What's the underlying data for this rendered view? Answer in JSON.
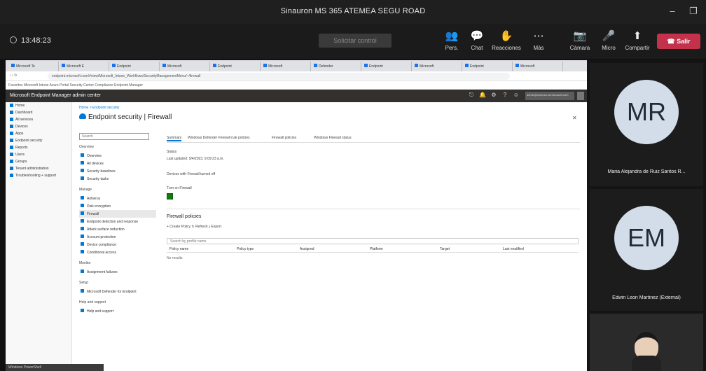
{
  "window": {
    "title": "Sinauron MS 365 ATEMEA SEGU ROAD",
    "min": "–",
    "restore": "❐"
  },
  "meeting": {
    "timer": "13:48:23",
    "take_control": "Solicitar control",
    "tools": [
      {
        "icon": "people-icon",
        "glyph": "👥",
        "label": "Pers."
      },
      {
        "icon": "chat-icon",
        "glyph": "💬",
        "label": "Chat"
      },
      {
        "icon": "reactions-icon",
        "glyph": "✋",
        "label": "Reacciones"
      },
      {
        "icon": "more-icon",
        "glyph": "⋯",
        "label": "Más"
      },
      {
        "icon": "camera-icon",
        "glyph": "📷",
        "label": "Cámara"
      },
      {
        "icon": "mic-icon",
        "glyph": "🎤",
        "label": "Micro"
      },
      {
        "icon": "share-icon",
        "glyph": "⬆",
        "label": "Compartir"
      }
    ],
    "leave_label": "Salir",
    "leave_color": "#c4314b"
  },
  "browser": {
    "tabs": [
      "Microsoft Te",
      "Microsoft E",
      "Endpoint",
      "Microsoft",
      "Endpoint",
      "Microsoft",
      "Defender",
      "Endpoint",
      "Microsoft",
      "Endpoint",
      "Microsoft"
    ],
    "address": "endpoint.microsoft.com/#view/Microsoft_Intune_Workflows/SecurityManagementMenu/~/firewall",
    "bookmarks": "Favoritos   Microsoft   Intune   Azure Portal   Security Center   Compliance   Endpoint Manager"
  },
  "portal": {
    "app_title": "Microsoft Endpoint Manager admin center",
    "account": "admin@contoso.onmicrosoft.com",
    "left_nav": [
      "Home",
      "Dashboard",
      "All services",
      "Devices",
      "Apps",
      "Endpoint security",
      "Reports",
      "Users",
      "Groups",
      "Tenant administration",
      "Troubleshooting + support"
    ],
    "breadcrumb": "Home > Endpoint security",
    "page_title": "Endpoint security | Firewall",
    "search_placeholder": "Search",
    "subnav_groups": [
      {
        "title": "Overview",
        "items": [
          "Overview",
          "All devices",
          "Security baselines",
          "Security tasks"
        ]
      },
      {
        "title": "Manage",
        "items": [
          "Antivirus",
          "Disk encryption",
          "Firewall",
          "Endpoint detection and response",
          "Attack surface reduction",
          "Account protection",
          "Device compliance",
          "Conditional access"
        ]
      },
      {
        "title": "Monitor",
        "items": [
          "Assignment failures"
        ]
      },
      {
        "title": "Setup",
        "items": [
          "Microsoft Defender for Endpoint"
        ]
      },
      {
        "title": "Help and support",
        "items": [
          "Help and support"
        ]
      }
    ],
    "selected_item": "Firewall",
    "policy_tabs": [
      "Summary",
      "Windows Defender Firewall rule policies",
      "Firewall policies",
      "Windows Firewall status"
    ],
    "info": {
      "status_label": "Status",
      "status_value": "Last updated: 5/4/2023, 9:09:23 a.m.",
      "managed_label": "Devices with Firewall turned off",
      "onboard_label": "Turn on Firewall"
    },
    "policies_title": "Firewall policies",
    "actions": "+ Create Policy   ↻ Refresh   ⤓ Export",
    "filter_placeholder": "Search by profile name",
    "columns": [
      "Policy name",
      "Policy type",
      "Assigned",
      "Platform",
      "Target",
      "Last modified"
    ],
    "no_results": "No results"
  },
  "taskbar_chip": "Windows PowerShell",
  "participants": [
    {
      "initials": "MR",
      "name": "Maria Alejandra de Ruiz Santos R..."
    },
    {
      "initials": "EM",
      "name": "Edwin Leon Martinez (External)"
    }
  ]
}
